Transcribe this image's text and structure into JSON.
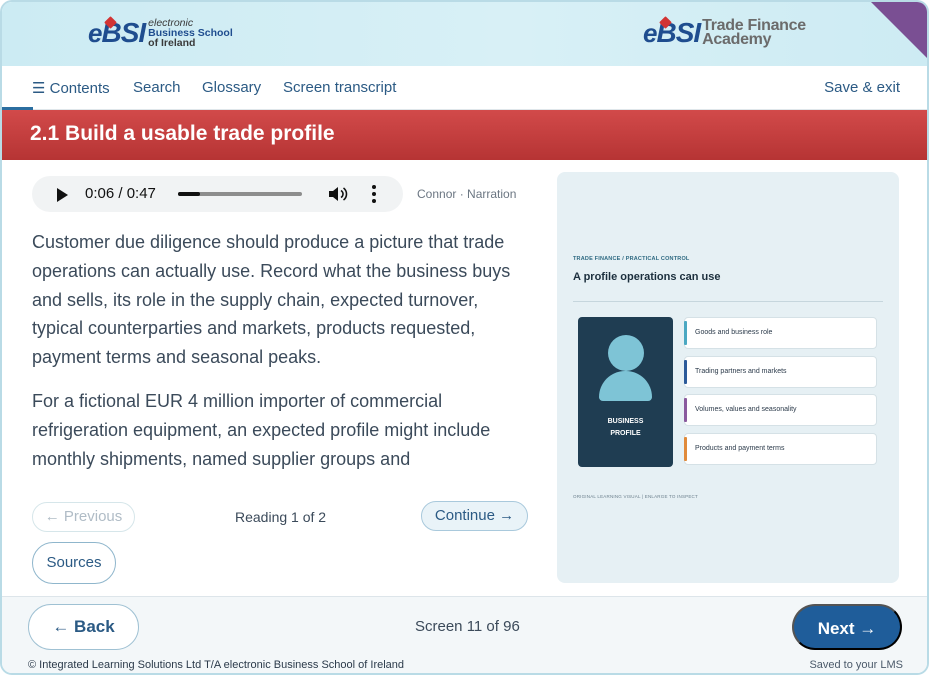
{
  "header": {
    "left_logo": {
      "mark_e": "e",
      "mark_bsi": "BSI",
      "line1": "electronic",
      "line2": "Business School",
      "line3": "of Ireland"
    },
    "right_logo": {
      "mark_e": "e",
      "mark_bsi": "BSI",
      "line1": "Trade Finance",
      "line2": "Academy"
    },
    "corner_color": "#7a4f93"
  },
  "nav": {
    "contents": "☰ Contents",
    "search": "Search",
    "glossary": "Glossary",
    "transcript": "Screen transcript",
    "save_exit": "Save & exit"
  },
  "title": "2.1 Build a usable trade profile",
  "audio": {
    "time": "0:06 / 0:47",
    "progress": 0.18,
    "play_icon": "play-icon",
    "volume_icon": "volume-icon",
    "more_icon": "more-vertical-icon",
    "narration": "Connor · Narration"
  },
  "body": {
    "paragraphs": [
      "Customer due diligence should produce a picture that trade operations can actually use. Record what the business buys and sells, its role in the supply chain, expected turnover, typical counterparties and markets, products requested, payment terms and seasonal peaks.",
      "For a fictional EUR 4 million importer of commercial refrigeration equipment, an expected profile might include monthly shipments, named supplier groups and"
    ]
  },
  "reading": {
    "previous": "← Previous",
    "status": "Reading 1 of 2",
    "continue": "Continue →",
    "sources": "Sources"
  },
  "visual": {
    "kicker": "TRADE FINANCE / PRACTICAL CONTROL",
    "title": "A profile operations can use",
    "card_label_1": "BUSINESS",
    "card_label_2": "PROFILE",
    "items": [
      {
        "label": "Goods and business role",
        "color": "#4ba8c2"
      },
      {
        "label": "Trading partners and markets",
        "color": "#2b5a9a"
      },
      {
        "label": "Volumes, values and seasonality",
        "color": "#8a5a9e"
      },
      {
        "label": "Products and payment terms",
        "color": "#e08a3a"
      }
    ],
    "caption": "ORIGINAL LEARNING VISUAL | ENLARGE TO INSPECT"
  },
  "footer": {
    "back": "← Back",
    "screen": "Screen 11 of 96",
    "next": "Next →",
    "copyright": "© Integrated Learning Solutions Ltd T/A electronic Business School of Ireland",
    "saved": "Saved to your LMS"
  }
}
